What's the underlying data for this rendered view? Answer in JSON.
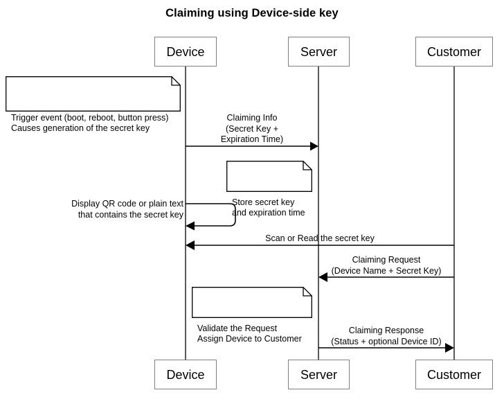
{
  "title": "Claiming using Device-side key",
  "participants": [
    {
      "name": "Device",
      "id": "device"
    },
    {
      "name": "Server",
      "id": "server"
    },
    {
      "name": "Customer",
      "id": "customer"
    }
  ],
  "participants_bottom": [
    {
      "name": "Device",
      "id": "device"
    },
    {
      "name": "Server",
      "id": "server"
    },
    {
      "name": "Customer",
      "id": "customer"
    }
  ],
  "notes": [
    {
      "id": "note-trigger-event",
      "text": "Trigger event (boot, reboot, button press)\nCauses generation of the secret key"
    },
    {
      "id": "note-store-secret-key",
      "text": "Store secret key\nand expiration time"
    },
    {
      "id": "note-validate-request",
      "text": "Validate the Request\nAssign Device to Customer"
    }
  ],
  "messages": [
    {
      "id": "msg-claiming-info",
      "text": "Claiming Info\n(Secret Key +\nExpiration Time)",
      "from": "Device",
      "to": "Server",
      "direction": "right"
    },
    {
      "id": "msg-display-qr-code",
      "text": "Display QR code or plain text\nthat contains the secret key",
      "from": "Device",
      "to": "Device",
      "direction": "self"
    },
    {
      "id": "msg-scan-or-read",
      "text": "Scan or Read the secret key",
      "from": "Customer",
      "to": "Device",
      "direction": "left"
    },
    {
      "id": "msg-claiming-request",
      "text": "Claiming Request\n(Device Name + Secret Key)",
      "from": "Customer",
      "to": "Server",
      "direction": "left"
    },
    {
      "id": "msg-claiming-response",
      "text": "Claiming Response\n(Status + optional Device ID)",
      "from": "Server",
      "to": "Customer",
      "direction": "right"
    }
  ],
  "colors": {
    "background": "#ffffff",
    "line": "#000000",
    "box_border": "#808080",
    "text": "#000000"
  }
}
